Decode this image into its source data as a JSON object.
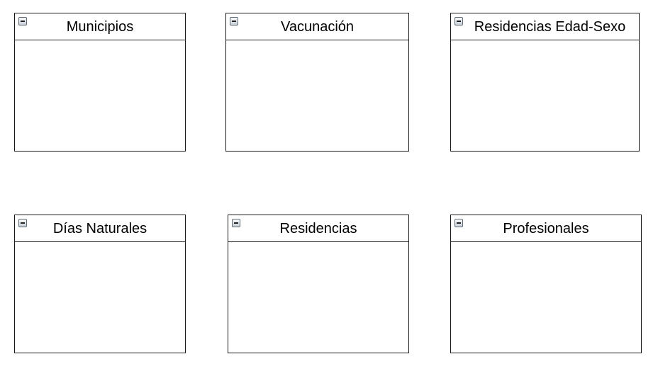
{
  "entities": [
    {
      "title": "Municipios",
      "icon": "minus-square-icon"
    },
    {
      "title": "Vacunación",
      "icon": "minus-square-icon"
    },
    {
      "title": "Residencias Edad-Sexo",
      "icon": "minus-square-icon"
    },
    {
      "title": "Días Naturales",
      "icon": "minus-square-icon"
    },
    {
      "title": "Residencias",
      "icon": "minus-square-icon"
    },
    {
      "title": "Profesionales",
      "icon": "minus-square-icon"
    }
  ],
  "colors": {
    "border": "#1a1a1a",
    "background": "#ffffff",
    "icon_border": "#5e6a76"
  }
}
